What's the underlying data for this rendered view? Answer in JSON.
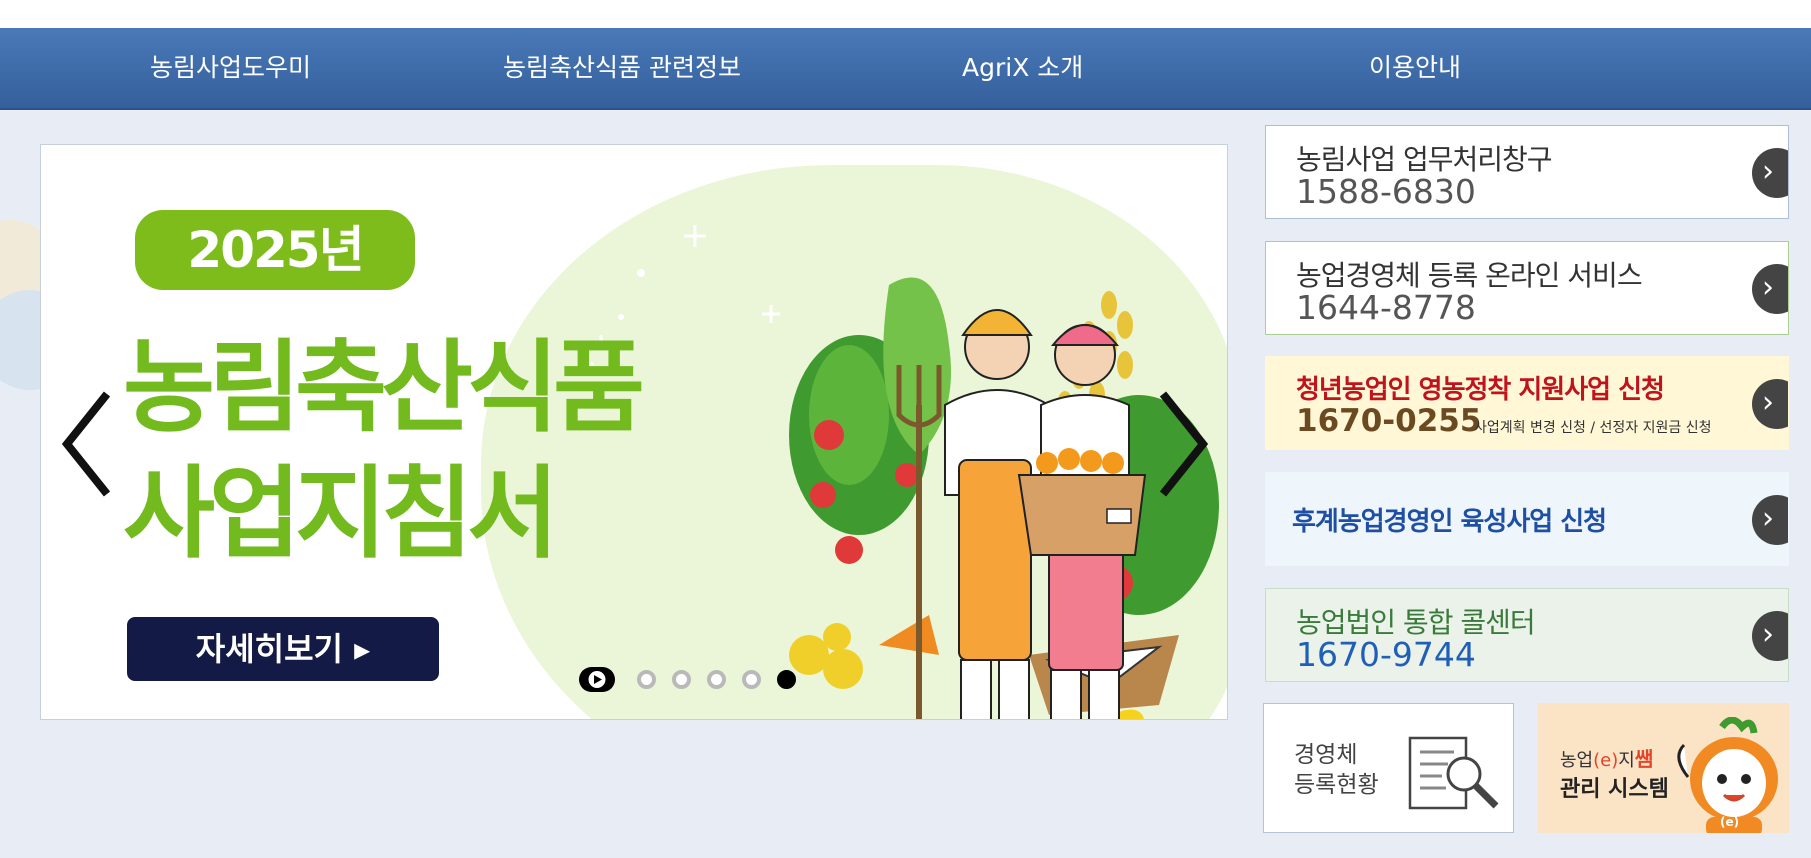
{
  "nav": {
    "items": [
      "농림사업도우미",
      "농림축산식품 관련정보",
      "AgriX 소개",
      "이용안내"
    ]
  },
  "slide": {
    "year": "2025년",
    "title_line1": "농림축산식품",
    "title_line2": "사업지침서",
    "detail_button": "자세히보기 ▸",
    "prev_icon": "chevron-left-icon",
    "next_icon": "chevron-right-icon",
    "dot_count": 5,
    "active_dot": 5
  },
  "panels": [
    {
      "title": "농림사업 업무처리창구",
      "phone": "1588-6830",
      "note": ""
    },
    {
      "title": "농업경영체 등록 온라인 서비스",
      "phone": "1644-8778",
      "note": ""
    },
    {
      "title": "청년농업인 영농정착 지원사업 신청",
      "phone": "1670-0255",
      "note": "사업계획 변경 신청 / 선정자 지원금 신청"
    },
    {
      "title": "후계농업경영인 육성사업 신청",
      "phone": "",
      "note": ""
    },
    {
      "title": "농업법인 통합 콜센터",
      "phone": "1670-9744",
      "note": ""
    }
  ],
  "status_box": {
    "line1": "경영체",
    "line2": "등록현황"
  },
  "mgmt_box": {
    "small": "농업",
    "e": "(e)",
    "ji": "지",
    "ssam": "쌤",
    "label": "관리 시스템",
    "badge": "(e)"
  },
  "colors": {
    "nav": "#3f6fae",
    "green": "#72ba1e",
    "navy_button": "#131a45",
    "red_title": "#c0141c",
    "blue_title": "#1f4fa3",
    "youth_bg": "#fff7d6",
    "successor_bg": "#eef6fc",
    "corp_bg": "#eaf2ea"
  }
}
